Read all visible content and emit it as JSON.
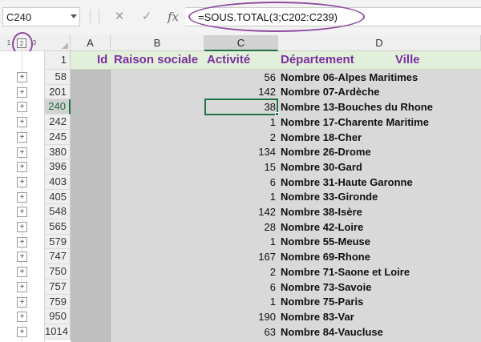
{
  "formula_bar": {
    "name_box": "C240",
    "cancel_icon": "✕",
    "enter_icon": "✓",
    "fx_label": "fx",
    "formula": "=SOUS.TOTAL(3;C202:C239)"
  },
  "outline": {
    "levels": [
      "1",
      "2",
      "3"
    ],
    "active_level": "2",
    "expand_symbol": "+"
  },
  "columns": [
    "A",
    "B",
    "C",
    "D"
  ],
  "selected_column": "C",
  "header_row": {
    "row_number": "1",
    "labels": {
      "id": "Id",
      "raison_sociale": "Raison sociale",
      "activite": "Activité",
      "departement": "Département",
      "ville": "Ville"
    }
  },
  "rows": [
    {
      "row": "58",
      "value": "56",
      "label": "Nombre 06-Alpes Maritimes"
    },
    {
      "row": "201",
      "value": "142",
      "label": "Nombre 07-Ardèche"
    },
    {
      "row": "240",
      "value": "38",
      "label": "Nombre 13-Bouches du Rhone"
    },
    {
      "row": "242",
      "value": "1",
      "label": "Nombre 17-Charente Maritime"
    },
    {
      "row": "245",
      "value": "2",
      "label": "Nombre 18-Cher"
    },
    {
      "row": "380",
      "value": "134",
      "label": "Nombre 26-Drome"
    },
    {
      "row": "396",
      "value": "15",
      "label": "Nombre 30-Gard"
    },
    {
      "row": "403",
      "value": "6",
      "label": "Nombre 31-Haute Garonne"
    },
    {
      "row": "405",
      "value": "1",
      "label": "Nombre 33-Gironde"
    },
    {
      "row": "548",
      "value": "142",
      "label": "Nombre 38-Isère"
    },
    {
      "row": "565",
      "value": "28",
      "label": "Nombre 42-Loire"
    },
    {
      "row": "579",
      "value": "1",
      "label": "Nombre 55-Meuse"
    },
    {
      "row": "747",
      "value": "167",
      "label": "Nombre 69-Rhone"
    },
    {
      "row": "750",
      "value": "2",
      "label": "Nombre 71-Saone et Loire"
    },
    {
      "row": "757",
      "value": "6",
      "label": "Nombre 73-Savoie"
    },
    {
      "row": "759",
      "value": "1",
      "label": "Nombre 75-Paris"
    },
    {
      "row": "950",
      "value": "190",
      "label": "Nombre 83-Var"
    },
    {
      "row": "1014",
      "value": "63",
      "label": "Nombre 84-Vaucluse"
    }
  ],
  "selected_row": "240",
  "colors": {
    "accent_green": "#217346",
    "header_fill": "#e2efda",
    "header_text": "#7b2fa0",
    "annotation": "#8e4aa0"
  }
}
